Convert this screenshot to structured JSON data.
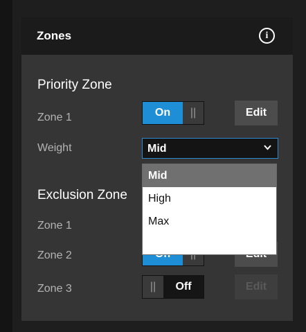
{
  "header": {
    "title": "Zones",
    "info_icon": "info-icon"
  },
  "priority": {
    "title": "Priority Zone",
    "zone1": {
      "label": "Zone 1",
      "toggle": "On",
      "edit": "Edit"
    },
    "weight": {
      "label": "Weight",
      "value": "Mid",
      "options": [
        "Mid",
        "High",
        "Max"
      ]
    }
  },
  "exclusion": {
    "title": "Exclusion Zone",
    "zone1": {
      "label": "Zone 1"
    },
    "zone2": {
      "label": "Zone 2",
      "toggle": "On",
      "edit": "Edit"
    },
    "zone3": {
      "label": "Zone 3",
      "toggle": "Off",
      "edit": "Edit"
    }
  },
  "colors": {
    "accent": "#1e8fd6",
    "panel": "#353535",
    "header": "#1b1b1b",
    "selected_option": "#707070"
  }
}
